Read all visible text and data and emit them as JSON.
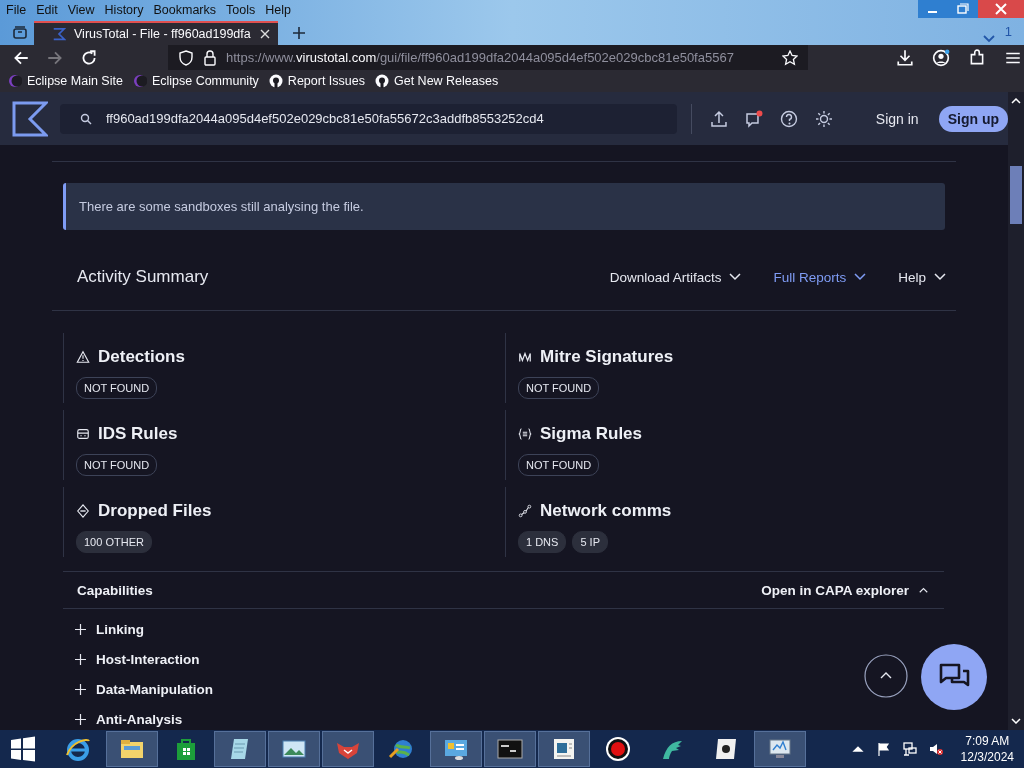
{
  "browser": {
    "menu": [
      "File",
      "Edit",
      "View",
      "History",
      "Bookmarks",
      "Tools",
      "Help"
    ],
    "tab": {
      "title": "VirusTotal - File - ff960ad199dfa",
      "selected": true
    },
    "tab_count": "1",
    "url": {
      "prefix": "https://www.",
      "host": "virustotal.com",
      "path": "/gui/file/ff960ad199dfa2044a095d4ef502e029cbc81e50fa5567"
    },
    "bookmarks": [
      {
        "label": "Eclipse Main Site",
        "kind": "eclipse"
      },
      {
        "label": "Eclipse Community",
        "kind": "eclipse"
      },
      {
        "label": "Report Issues",
        "kind": "github"
      },
      {
        "label": "Get New Releases",
        "kind": "github"
      }
    ]
  },
  "header": {
    "search_value": "ff960ad199dfa2044a095d4ef502e029cbc81e50fa55672c3addfb8553252cd4",
    "notification": true,
    "sign_in": "Sign in",
    "sign_up": "Sign up"
  },
  "notice": "There are some sandboxes still analysing the file.",
  "activity": {
    "title": "Activity Summary",
    "menus": [
      {
        "label": "Download Artifacts",
        "hovered": false
      },
      {
        "label": "Full Reports",
        "hovered": true
      },
      {
        "label": "Help",
        "hovered": false
      }
    ],
    "cards": [
      {
        "title": "Detections",
        "kind": "warning",
        "tags": [
          {
            "label": "NOT FOUND",
            "kind": "outline"
          }
        ]
      },
      {
        "title": "Mitre Signatures",
        "kind": "mitre",
        "tags": [
          {
            "label": "NOT FOUND",
            "kind": "outline"
          }
        ]
      },
      {
        "title": "IDS Rules",
        "kind": "ids",
        "tags": [
          {
            "label": "NOT FOUND",
            "kind": "outline"
          }
        ]
      },
      {
        "title": "Sigma Rules",
        "kind": "sigma",
        "tags": [
          {
            "label": "NOT FOUND",
            "kind": "outline"
          }
        ]
      },
      {
        "title": "Dropped Files",
        "kind": "dropped",
        "tags": [
          {
            "label": "100 OTHER",
            "kind": "filled"
          }
        ]
      },
      {
        "title": "Network comms",
        "kind": "network",
        "tags": [
          {
            "label": "1 DNS",
            "kind": "filled"
          },
          {
            "label": "5 IP",
            "kind": "filled"
          }
        ]
      }
    ]
  },
  "capabilities": {
    "title": "Capabilities",
    "link": "Open in CAPA explorer",
    "expanded": true,
    "items": [
      {
        "label": "Linking",
        "expanded": false
      },
      {
        "label": "Host-Interaction",
        "expanded": false
      },
      {
        "label": "Data-Manipulation",
        "expanded": false
      },
      {
        "label": "Anti-Analysis",
        "expanded": false
      }
    ]
  },
  "taskbar": {
    "time": "7:09 AM",
    "date": "12/3/2024",
    "apps": [
      {
        "kind": "browser",
        "running": false
      },
      {
        "kind": "folder",
        "running": true
      },
      {
        "kind": "store",
        "running": false
      },
      {
        "kind": "notepad",
        "running": true
      },
      {
        "kind": "photo",
        "running": true
      },
      {
        "kind": "fox",
        "running": true
      },
      {
        "kind": "globe",
        "running": false
      },
      {
        "kind": "panel",
        "running": true
      },
      {
        "kind": "terminal",
        "running": true
      },
      {
        "kind": "document",
        "running": true
      },
      {
        "kind": "record",
        "running": false
      },
      {
        "kind": "fin",
        "running": false
      },
      {
        "kind": "disc",
        "running": false
      },
      {
        "kind": "monitor",
        "running": true
      }
    ]
  }
}
